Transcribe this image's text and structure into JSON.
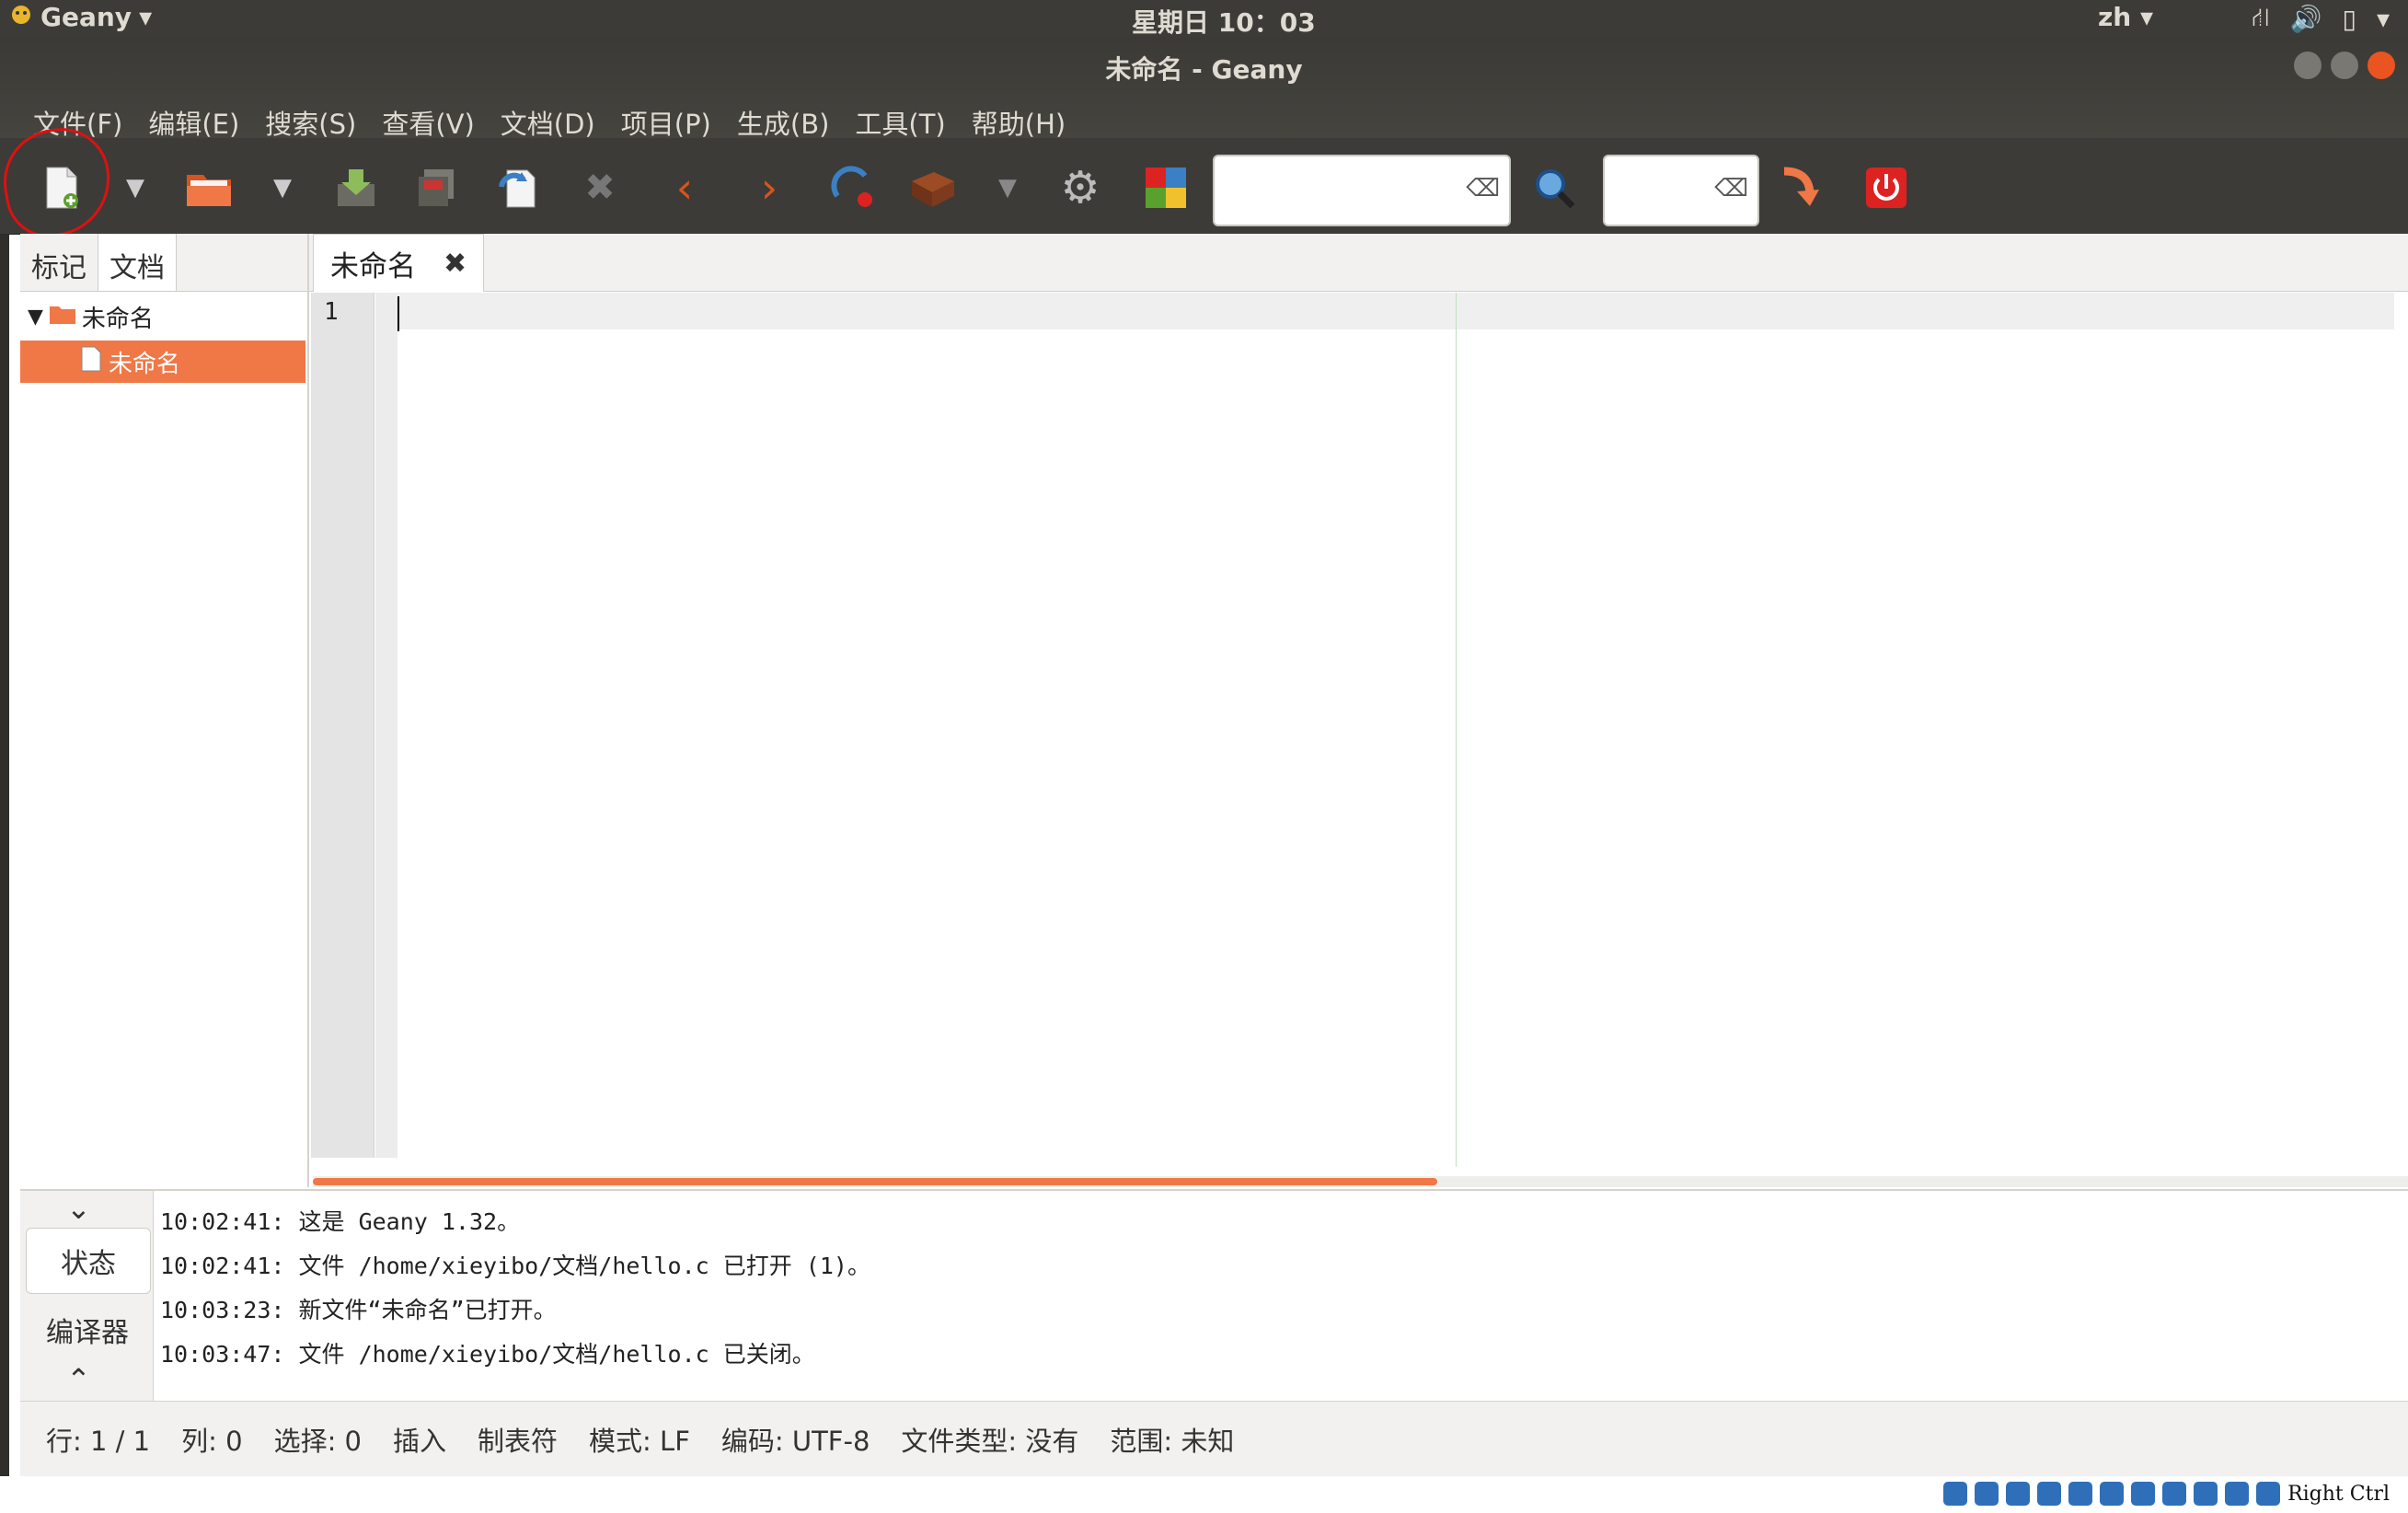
{
  "topbar": {
    "app_name": "Geany",
    "clock": "星期日 10：03",
    "lang": "zh"
  },
  "window": {
    "title": "未命名 - Geany"
  },
  "menu": [
    "文件(F)",
    "编辑(E)",
    "搜索(S)",
    "查看(V)",
    "文档(D)",
    "项目(P)",
    "生成(B)",
    "工具(T)",
    "帮助(H)"
  ],
  "toolbar": {
    "icons": [
      "new-file-icon",
      "dropdown-arrow-icon",
      "open-folder-icon",
      "dropdown-arrow-icon",
      "save-icon",
      "save-all-icon",
      "revert-icon",
      "close-icon",
      "back-icon",
      "forward-icon",
      "compile-icon",
      "build-icon",
      "dropdown-arrow-icon",
      "preferences-gear-icon",
      "color-chooser-icon",
      "search-icon",
      "goto-line-icon",
      "quit-icon"
    ],
    "search_value": "",
    "goto_value": "",
    "accent": "#f07746"
  },
  "sidebar": {
    "tabs": [
      "标记",
      "文档"
    ],
    "tree_root": "未命名",
    "tree_child": "未命名"
  },
  "editor": {
    "tab_label": "未命名",
    "line_number": "1"
  },
  "messages": {
    "tabs": [
      "状态",
      "编译器"
    ],
    "lines": [
      "10:02:41: 这是 Geany 1.32。",
      "10:02:41: 文件 /home/xieyibo/文档/hello.c 已打开 (1)。",
      "10:03:23: 新文件“未命名”已打开。",
      "10:03:47: 文件 /home/xieyibo/文档/hello.c 已关闭。"
    ]
  },
  "status": {
    "line": "行: 1 / 1",
    "col": "列: 0",
    "sel": "选择: 0",
    "mode_ins": "插入",
    "indent": "制表符",
    "eol": "模式: LF",
    "enc": "编码: UTF-8",
    "ftype": "文件类型: 没有",
    "scope": "范围: 未知"
  },
  "vm": {
    "host_key": "Right Ctrl"
  }
}
